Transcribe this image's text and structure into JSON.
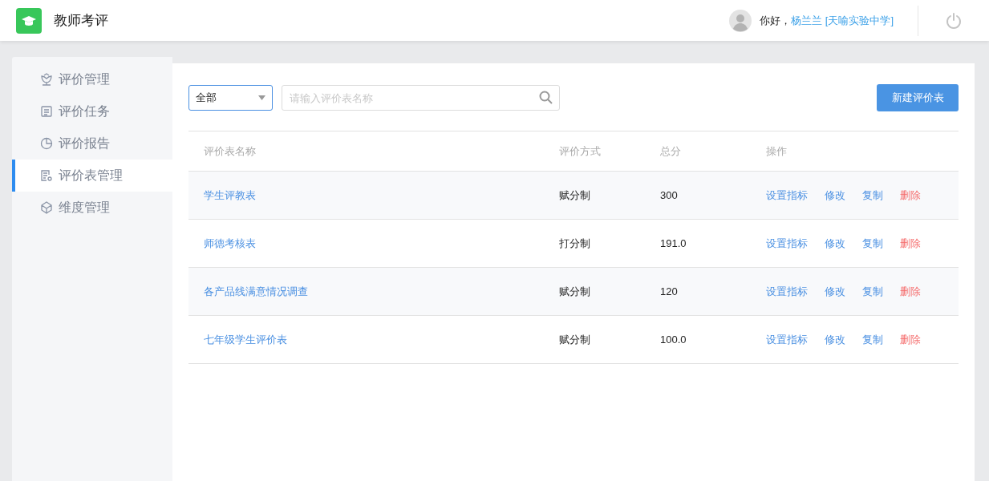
{
  "header": {
    "app_title": "教师考评",
    "greeting": "你好，",
    "user": "杨兰兰 [天喻实验中学]"
  },
  "sidebar": {
    "items": [
      {
        "label": "评价管理",
        "selected": false
      },
      {
        "label": "评价任务",
        "selected": false
      },
      {
        "label": "评价报告",
        "selected": false
      },
      {
        "label": "评价表管理",
        "selected": true
      },
      {
        "label": "维度管理",
        "selected": false
      }
    ]
  },
  "toolbar": {
    "filter": "全部",
    "search": {
      "placeholder": "请输入评价表名称"
    },
    "new_button": "新建评价表"
  },
  "table": {
    "columns": [
      "评价表名称",
      "评价方式",
      "总分",
      "操作"
    ],
    "rows": [
      {
        "name": "学生评教表",
        "method": "赋分制",
        "total": "300",
        "actions": [
          {
            "label": "设置指标",
            "kind": "link"
          },
          {
            "label": "修改",
            "kind": "link"
          },
          {
            "label": "复制",
            "kind": "link"
          },
          {
            "label": "删除",
            "kind": "danger"
          }
        ]
      },
      {
        "name": "师德考核表",
        "method": "打分制",
        "total": "191.0",
        "actions": [
          {
            "label": "设置指标",
            "kind": "link"
          },
          {
            "label": "修改",
            "kind": "link"
          },
          {
            "label": "复制",
            "kind": "link"
          },
          {
            "label": "删除",
            "kind": "danger"
          }
        ]
      },
      {
        "name": "各产品线满意情况调查",
        "method": "赋分制",
        "total": "120",
        "actions": [
          {
            "label": "设置指标",
            "kind": "link"
          },
          {
            "label": "修改",
            "kind": "link"
          },
          {
            "label": "复制",
            "kind": "link"
          },
          {
            "label": "删除",
            "kind": "danger"
          }
        ]
      },
      {
        "name": "七年级学生评价表",
        "method": "赋分制",
        "total": "100.0",
        "actions": [
          {
            "label": "设置指标",
            "kind": "link"
          },
          {
            "label": "修改",
            "kind": "link"
          },
          {
            "label": "复制",
            "kind": "link"
          },
          {
            "label": "删除",
            "kind": "danger"
          }
        ]
      }
    ]
  }
}
